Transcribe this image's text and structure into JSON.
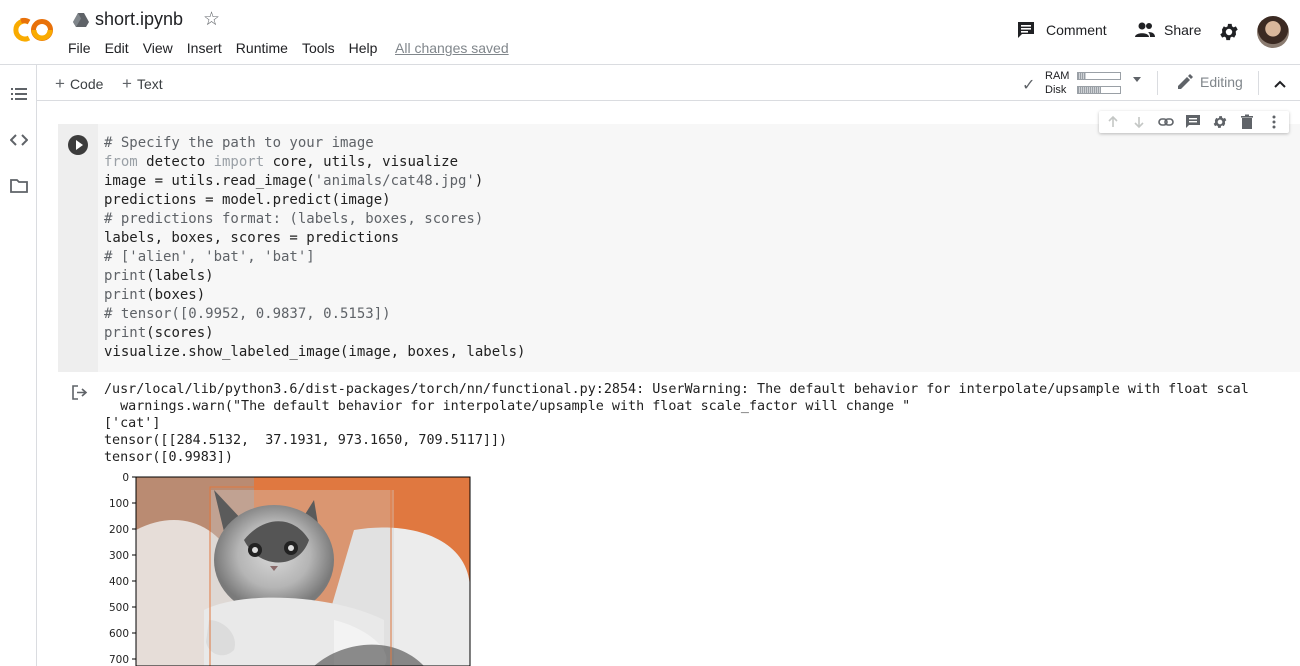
{
  "header": {
    "doc_title": "short.ipynb",
    "menu": [
      "File",
      "Edit",
      "View",
      "Insert",
      "Runtime",
      "Tools",
      "Help"
    ],
    "save_status": "All changes saved",
    "comment_label": "Comment",
    "share_label": "Share"
  },
  "toolbar": {
    "add_code": "Code",
    "add_text": "Text",
    "ram_label": "RAM",
    "disk_label": "Disk",
    "ram_usage": 0.2,
    "disk_usage": 0.55,
    "mode": "Editing"
  },
  "cell": {
    "lines": [
      [
        {
          "t": "# Specify the path to your image",
          "c": "comment"
        }
      ],
      [
        {
          "t": "from",
          "c": "kw"
        },
        {
          "t": " detecto ",
          "c": ""
        },
        {
          "t": "import",
          "c": "kw"
        },
        {
          "t": " core, utils, visualize",
          "c": ""
        }
      ],
      [
        {
          "t": "image = utils.read_image(",
          "c": ""
        },
        {
          "t": "'animals/cat48.jpg'",
          "c": "str"
        },
        {
          "t": ")",
          "c": ""
        }
      ],
      [
        {
          "t": "predictions = model.predict(image)",
          "c": ""
        }
      ],
      [
        {
          "t": "# predictions format: (labels, boxes, scores)",
          "c": "comment"
        }
      ],
      [
        {
          "t": "labels, boxes, scores = predictions",
          "c": ""
        }
      ],
      [
        {
          "t": "# ['alien', 'bat', 'bat']",
          "c": "comment"
        }
      ],
      [
        {
          "t": "print",
          "c": "fn"
        },
        {
          "t": "(labels)",
          "c": ""
        }
      ],
      [
        {
          "t": "print",
          "c": "fn"
        },
        {
          "t": "(boxes)",
          "c": ""
        }
      ],
      [
        {
          "t": "# tensor([0.9952, 0.9837, 0.5153])",
          "c": "comment"
        }
      ],
      [
        {
          "t": "print",
          "c": "fn"
        },
        {
          "t": "(scores)",
          "c": ""
        }
      ],
      [
        {
          "t": "visualize.show_labeled_image(image, boxes, labels)",
          "c": ""
        }
      ]
    ]
  },
  "output": {
    "warning_line": "/usr/local/lib/python3.6/dist-packages/torch/nn/functional.py:2854: UserWarning: The default behavior for interpolate/upsample with float scal",
    "warn_call": "  warnings.warn(\"The default behavior for interpolate/upsample with float scale_factor will change \"",
    "labels": "['cat']",
    "boxes": "tensor([[284.5132,  37.1931, 973.1650, 709.5117]])",
    "scores": "tensor([0.9983])"
  },
  "plot": {
    "yticks": [
      "0",
      "100",
      "200",
      "300",
      "400",
      "500",
      "600",
      "700"
    ],
    "colors": {
      "background": "#e07840",
      "box": "#e07840"
    }
  }
}
